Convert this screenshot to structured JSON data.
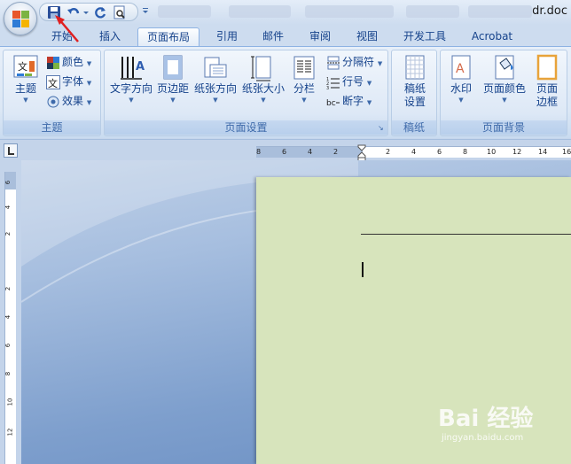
{
  "window": {
    "title": "dr.doc",
    "qat_icons": [
      "save-icon",
      "undo-icon",
      "dropdown-icon",
      "redo-icon",
      "print-preview-icon",
      "customize-icon"
    ]
  },
  "tabs": [
    {
      "label": "开始"
    },
    {
      "label": "插入"
    },
    {
      "label": "页面布局",
      "active": true
    },
    {
      "label": "引用"
    },
    {
      "label": "邮件"
    },
    {
      "label": "审阅"
    },
    {
      "label": "视图"
    },
    {
      "label": "开发工具"
    },
    {
      "label": "Acrobat"
    }
  ],
  "ribbon": {
    "themes": {
      "label": "主题",
      "theme_btn": "主题",
      "colors": "颜色",
      "fonts": "字体",
      "effects": "效果"
    },
    "page_setup": {
      "label": "页面设置",
      "text_direction": "文字方向",
      "margins": "页边距",
      "orientation": "纸张方向",
      "size": "纸张大小",
      "columns": "分栏",
      "breaks": "分隔符",
      "line_numbers": "行号",
      "hyphenation": "断字"
    },
    "manuscript": {
      "label": "稿纸",
      "setup_line1": "稿纸",
      "setup_line2": "设置"
    },
    "page_background": {
      "label": "页面背景",
      "watermark": "水印",
      "page_color": "页面颜色",
      "borders_line1": "页面",
      "borders_line2": "边框"
    }
  },
  "ruler": {
    "horizontal": [
      "8",
      "6",
      "4",
      "2",
      "2",
      "4",
      "6",
      "8",
      "10",
      "12",
      "14",
      "16"
    ],
    "vertical": [
      "6",
      "4",
      "2",
      "2",
      "4",
      "6",
      "8",
      "10",
      "12"
    ]
  },
  "watermark": {
    "brand": "Bai 经验",
    "url": "jingyan.baidu.com"
  },
  "colors": {
    "page_background": "#d7e4bc",
    "ribbon_text": "#15428b",
    "annotation_arrow": "#e02020"
  }
}
